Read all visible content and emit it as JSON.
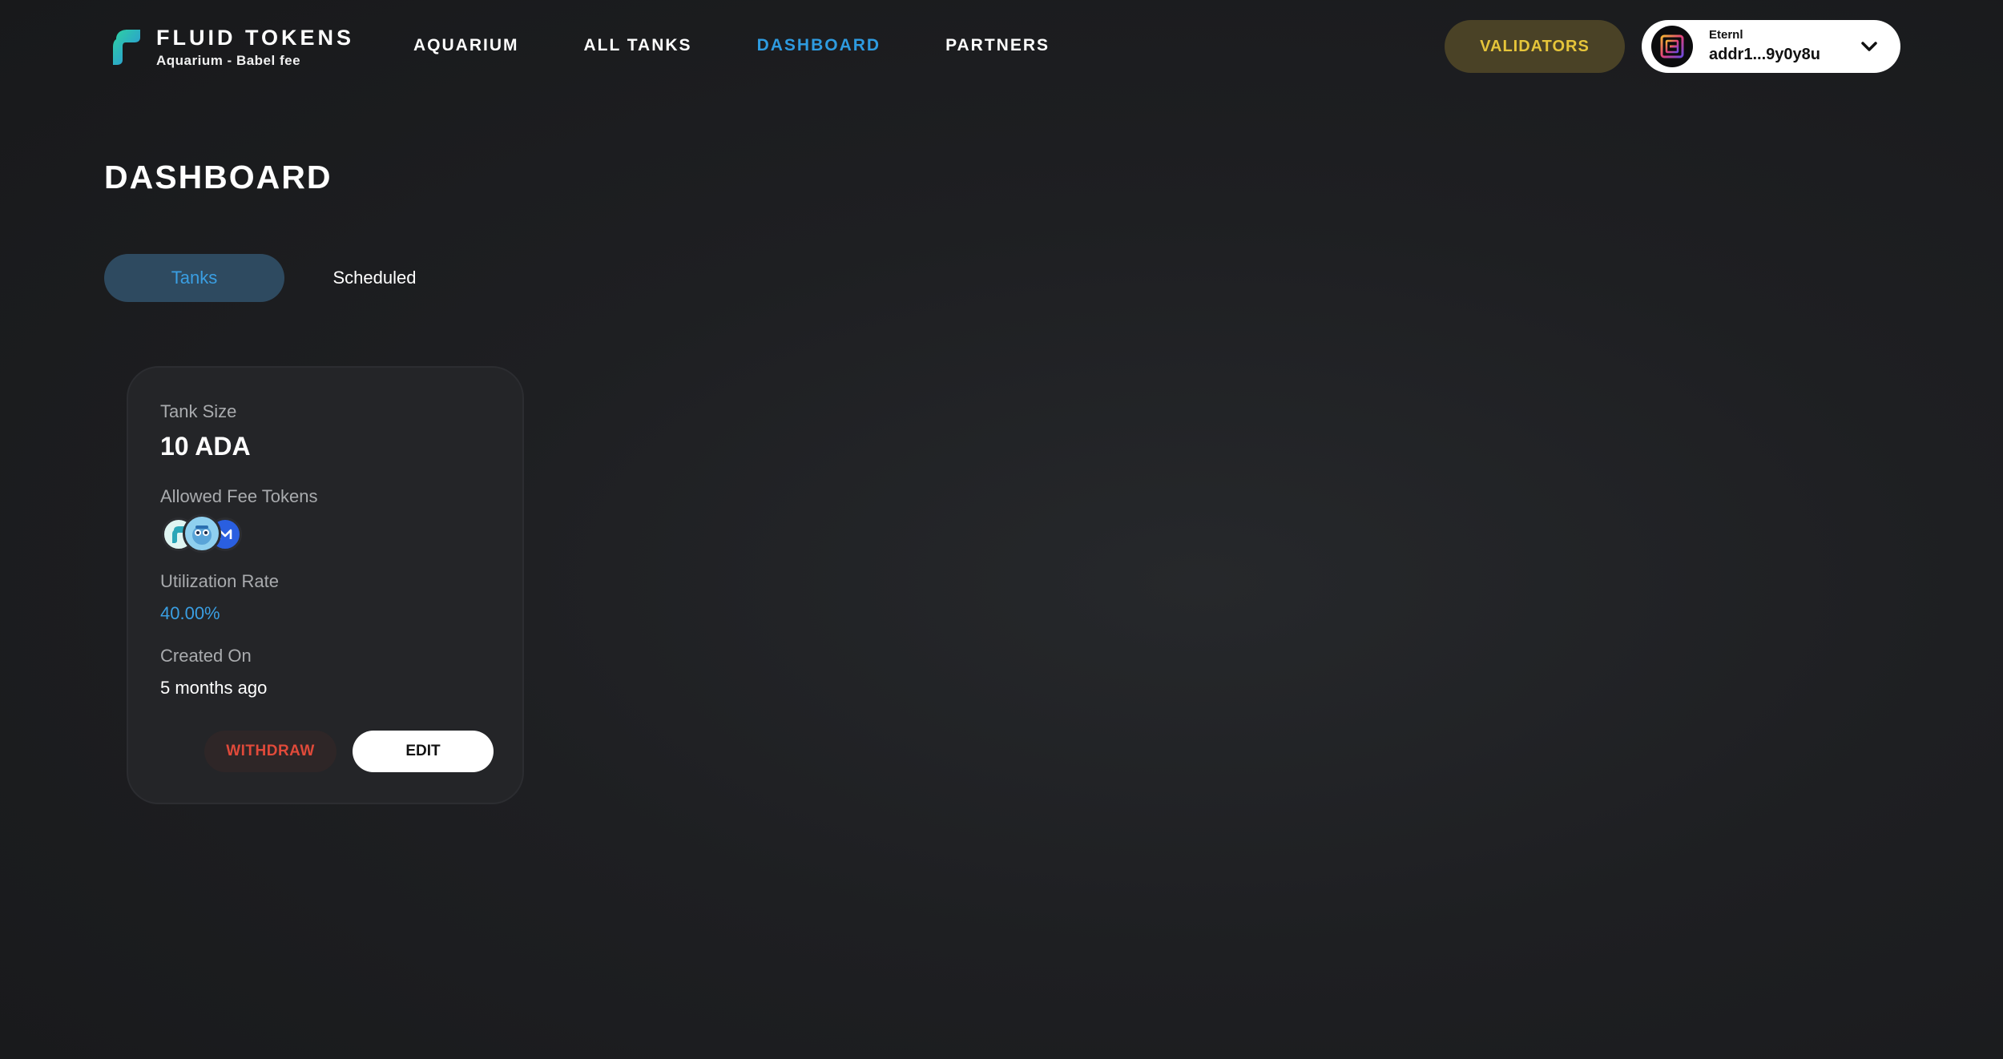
{
  "header": {
    "brand_title": "FLUID TOKENS",
    "brand_subtitle": "Aquarium - Babel fee",
    "nav": [
      {
        "label": "AQUARIUM"
      },
      {
        "label": "ALL TANKS"
      },
      {
        "label": "DASHBOARD",
        "active": true
      },
      {
        "label": "PARTNERS"
      }
    ],
    "validators_label": "VALIDATORS",
    "wallet": {
      "name": "Eternl",
      "address": "addr1...9y0y8u"
    }
  },
  "main": {
    "page_title": "DASHBOARD",
    "tabs": [
      {
        "label": "Tanks",
        "active": true
      },
      {
        "label": "Scheduled"
      }
    ],
    "card": {
      "tank_size_label": "Tank Size",
      "tank_size_value": "10 ADA",
      "allowed_fee_tokens_label": "Allowed Fee Tokens",
      "fee_token_icons": [
        "fluid-token-icon",
        "blue-creature-token-icon",
        "m-token-icon"
      ],
      "utilization_label": "Utilization Rate",
      "utilization_value": "40.00%",
      "created_label": "Created On",
      "created_value": "5 months ago",
      "withdraw_label": "WITHDRAW",
      "edit_label": "EDIT"
    }
  },
  "colors": {
    "accent_blue": "#2e9be0",
    "validators_text": "#e6c53a",
    "withdraw_text": "#e04a3a"
  }
}
